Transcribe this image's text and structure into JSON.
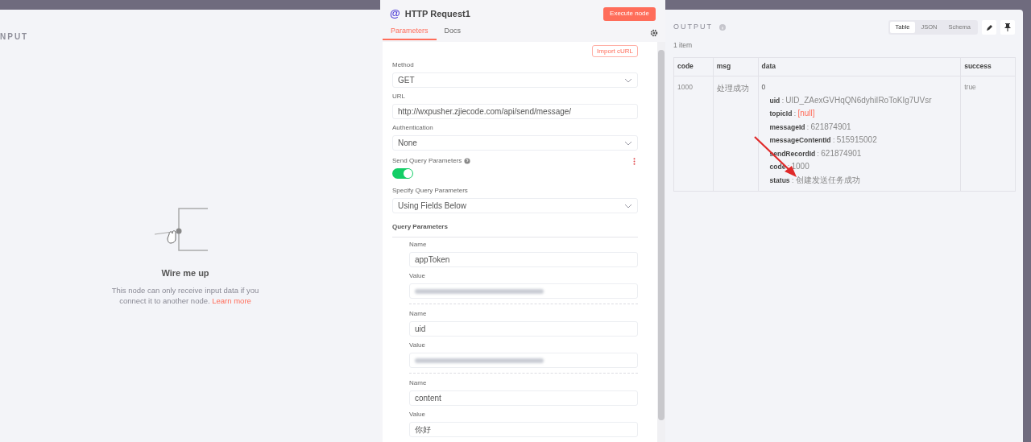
{
  "input_panel": {
    "title": "NPUT",
    "empty_state": {
      "title": "Wire me up",
      "text": "This node can only receive input data if you connect it to another node.",
      "link": "Learn more"
    }
  },
  "node_panel": {
    "icon": "@",
    "title": "HTTP Request1",
    "execute_button": "Execute node",
    "tabs": [
      {
        "label": "Parameters",
        "selected": true
      },
      {
        "label": "Docs",
        "selected": false
      }
    ],
    "import_button": "Import cURL",
    "fields": [
      {
        "kind": "select",
        "label": "Method",
        "value": "GET"
      },
      {
        "kind": "text",
        "label": "URL",
        "value": "http://wxpusher.zjiecode.com/api/send/message/"
      },
      {
        "kind": "select",
        "label": "Authentication",
        "value": "None"
      },
      {
        "kind": "toggle",
        "label": "Send Query Parameters",
        "on": true
      },
      {
        "kind": "select",
        "label": "Specify Query Parameters",
        "value": "Using Fields Below"
      }
    ],
    "query_parameters": {
      "title": "Query Parameters",
      "items": [
        {
          "name_label": "Name",
          "name": "appToken",
          "value_label": "Value",
          "redacted": true
        },
        {
          "name_label": "Name",
          "name": "uid",
          "value_label": "Value",
          "redacted": true
        },
        {
          "name_label": "Name",
          "name": "content",
          "value_label": "Value",
          "value": "你好"
        }
      ]
    }
  },
  "output_panel": {
    "title": "OUTPUT",
    "views": [
      {
        "label": "Table",
        "selected": true
      },
      {
        "label": "JSON",
        "selected": false
      },
      {
        "label": "Schema",
        "selected": false
      }
    ],
    "count": "1 item",
    "table": {
      "columns": [
        "code",
        "msg",
        "data",
        "success"
      ],
      "rows": [
        {
          "code": "1000",
          "msg": "处理成功",
          "data_index": "0",
          "data": [
            {
              "key": "uid",
              "sep": ":",
              "value": "UID_ZAexGVHqQN6dyhiIRoToKIg7UVsr",
              "null": false
            },
            {
              "key": "topicId",
              "sep": ":",
              "value": "[null]",
              "null": true
            },
            {
              "key": "messageId",
              "sep": ":",
              "value": "621874901",
              "null": false
            },
            {
              "key": "messageContentId",
              "sep": ":",
              "value": "515915002",
              "null": false
            },
            {
              "key": "sendRecordId",
              "sep": ":",
              "value": "621874901",
              "null": false
            },
            {
              "key": "code",
              "sep": ":",
              "value": "1000",
              "null": false
            },
            {
              "key": "status",
              "sep": ":",
              "value": "创建发送任务成功",
              "null": false
            }
          ],
          "success": "true"
        }
      ]
    }
  },
  "annotation": {
    "kind": "arrow",
    "color": "#e02a2a"
  }
}
